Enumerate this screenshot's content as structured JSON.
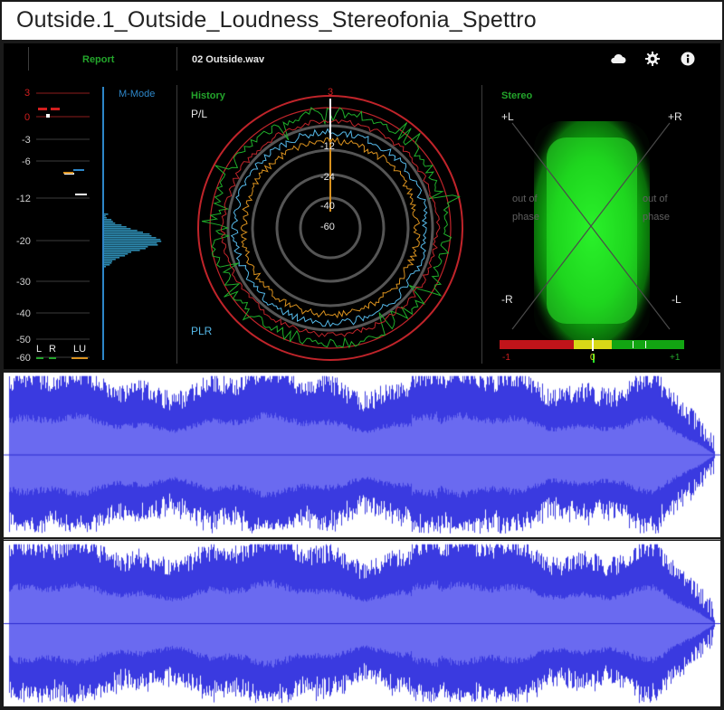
{
  "window": {
    "title": "Outside.1_Outside_Loudness_Stereofonia_Spettro"
  },
  "toolbar": {
    "report_label": "Report",
    "filename": "02 Outside.wav",
    "icons": [
      "cloud-icon",
      "gear-icon",
      "info-icon"
    ]
  },
  "level_meter": {
    "mode_label": "M-Mode",
    "scale": [
      "3",
      "0",
      "-3",
      "-6",
      "-12",
      "-20",
      "-30",
      "-40",
      "-50",
      "-60"
    ],
    "channel_labels": {
      "left": "L",
      "right": "R",
      "lu": "LU"
    }
  },
  "history": {
    "label": "History",
    "pl_label": "P/L",
    "plr_label": "PLR",
    "ring_labels": [
      "3",
      "-12",
      "-24",
      "-40",
      "-60"
    ],
    "colors": {
      "outer_ring": "#c0242a",
      "green": "#1fae2a",
      "orange": "#d9911e",
      "blue": "#55b8e8"
    }
  },
  "stereo": {
    "label": "Stereo",
    "corners": {
      "top_left": "+L",
      "top_right": "+R",
      "bottom_left": "-R",
      "bottom_right": "-L"
    },
    "out_of_phase_left": [
      "out of",
      "phase"
    ],
    "out_of_phase_right": [
      "out of",
      "phase"
    ],
    "correlation": {
      "min_label": "-1",
      "mid_label": "0",
      "max_label": "+1"
    }
  },
  "waveform": {
    "color": "#3a3ae0",
    "fill": "#6a6af0",
    "channels": 2
  },
  "colors": {
    "accent_green": "#23a52b",
    "accent_blue": "#2d86c8",
    "red": "#d11e1e"
  }
}
